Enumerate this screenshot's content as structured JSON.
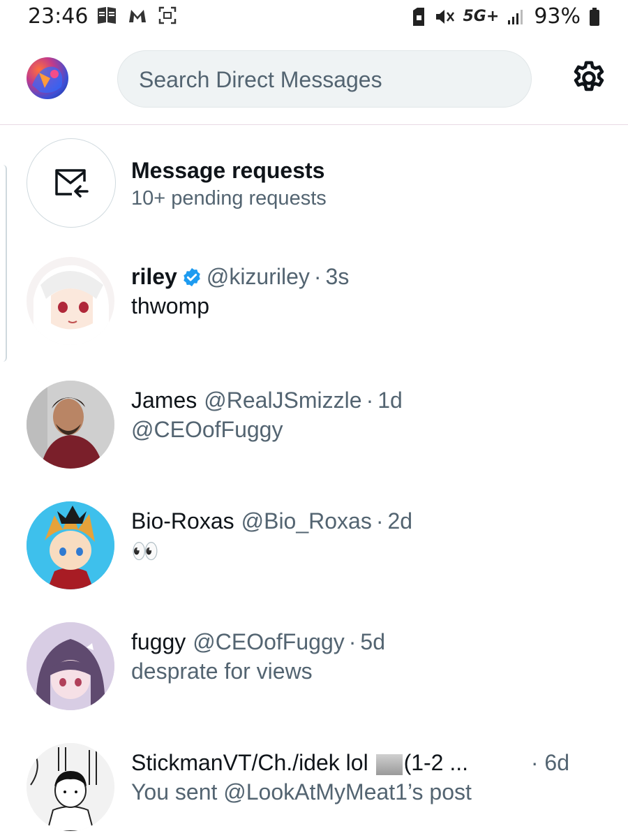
{
  "status_bar": {
    "time": "23:46",
    "network": "5G+",
    "battery": "93%"
  },
  "header": {
    "search_placeholder": "Search Direct Messages"
  },
  "message_requests": {
    "title": "Message requests",
    "subtitle": "10+ pending requests"
  },
  "conversations": [
    {
      "name": "riley",
      "verified": true,
      "handle": "@kizuriley",
      "time": "3s",
      "message": "thwomp"
    },
    {
      "name": "James",
      "verified": false,
      "handle": "@RealJSmizzle",
      "time": "1d",
      "message": "@CEOofFuggy"
    },
    {
      "name": "Bio-Roxas",
      "verified": false,
      "handle": "@Bio_Roxas",
      "time": "2d",
      "message": "👀"
    },
    {
      "name": "fuggy",
      "verified": false,
      "handle": "@CEOofFuggy",
      "time": "5d",
      "message": "desprate for views"
    },
    {
      "name_start": "StickmanVT/Ch./idek lol ",
      "name_end": "(1-2 ...",
      "verified": false,
      "handle": "",
      "time": "· 6d",
      "message": "You sent @LookAtMyMeat1’s post"
    }
  ],
  "colors": {
    "primary_text": "#0f1419",
    "secondary_text": "#536471",
    "verified_blue": "#1d9bf0",
    "search_bg": "#eff3f4"
  }
}
